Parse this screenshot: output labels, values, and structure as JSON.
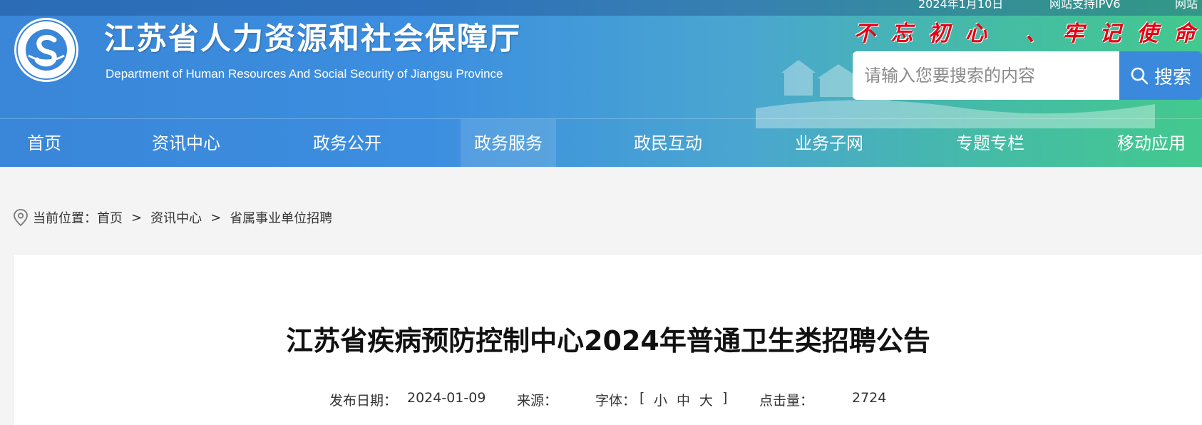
{
  "header": {
    "topbar": {
      "date": "2024年1月10日",
      "ipv6": "网站支持IPV6",
      "extra": "网站"
    },
    "site_title": "江苏省人力资源和社会保障厅",
    "site_subtitle": "Department of Human Resources And Social Security of Jiangsu Province",
    "slogan": "不忘初心 、牢记使命",
    "search": {
      "placeholder": "请输入您要搜索的内容",
      "button_label": "搜索"
    },
    "logo_text": "江苏省人力资源和社会保障厅"
  },
  "nav": {
    "items": [
      {
        "label": "首页"
      },
      {
        "label": "资讯中心"
      },
      {
        "label": "政务公开"
      },
      {
        "label": "政务服务"
      },
      {
        "label": "政民互动"
      },
      {
        "label": "业务子网"
      },
      {
        "label": "专题专栏"
      },
      {
        "label": "移动应用"
      }
    ],
    "active_index": 3
  },
  "breadcrumb": {
    "prefix": "当前位置：",
    "items": [
      "首页",
      "资讯中心",
      "省属事业单位招聘"
    ],
    "separator": ">"
  },
  "article": {
    "title": "江苏省疾病预防控制中心2024年普通卫生类招聘公告",
    "meta": {
      "date_label": "发布日期：",
      "date_value": "2024-01-09",
      "source_label": "来源：",
      "source_value": "",
      "font_label": "字体：",
      "font_open": "[",
      "font_small": "小",
      "font_medium": "中",
      "font_large": "大",
      "font_close": "]",
      "clicks_label": "点击量：",
      "clicks_value": "2724"
    }
  },
  "colors": {
    "header_start": "#3a86d8",
    "header_end": "#43c98e",
    "slogan": "#e60012",
    "search_button": "#3b89dc"
  },
  "icons": {
    "search": "search-icon",
    "location": "location-pin-icon",
    "logo": "department-logo-icon"
  }
}
